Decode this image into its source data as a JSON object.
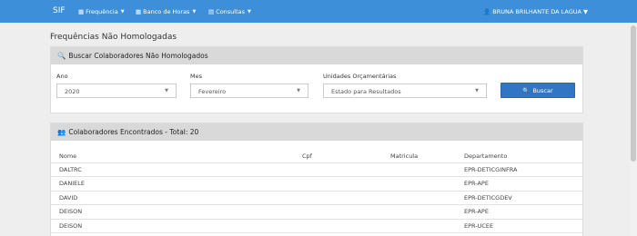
{
  "navbar": {
    "brand": "SIF",
    "menus": [
      {
        "label": "Frequência",
        "icon": "calendar-icon"
      },
      {
        "label": "Banco de Horas",
        "icon": "calendar-icon"
      },
      {
        "label": "Consultas",
        "icon": "file-icon"
      }
    ],
    "user": "BRUNA BRILHANTE DA LAGUA",
    "colors": {
      "accent": "#3c8fd8"
    }
  },
  "page": {
    "title": "Frequências Não Homologadas"
  },
  "search": {
    "heading": "Buscar Colaboradores Não Homologados",
    "ano_label": "Ano",
    "ano_value": "2020",
    "mes_label": "Mes",
    "mes_value": "Fevereiro",
    "unidades_label": "Unidades Orçamentárias",
    "unidades_value": "Estado para Resultados",
    "button_label": "Buscar",
    "button_color": "#3076c4"
  },
  "results": {
    "heading": "Colaboradores Encontrados - Total: 20",
    "columns": [
      "Nome",
      "Cpf",
      "Matricula",
      "Departamento"
    ],
    "rows": [
      {
        "nome": "DALTRC",
        "cpf": "",
        "matricula": "",
        "departamento": "EPR-DETICGINFRA"
      },
      {
        "nome": "DANIELE",
        "cpf": "",
        "matricula": "",
        "departamento": "EPR-APE"
      },
      {
        "nome": "DAVID",
        "cpf": "",
        "matricula": "",
        "departamento": "EPR-DETICGDEV"
      },
      {
        "nome": "DEISON",
        "cpf": "",
        "matricula": "",
        "departamento": "EPR-APE"
      },
      {
        "nome": "DEISON",
        "cpf": "",
        "matricula": "",
        "departamento": "EPR-UCEE"
      }
    ]
  }
}
